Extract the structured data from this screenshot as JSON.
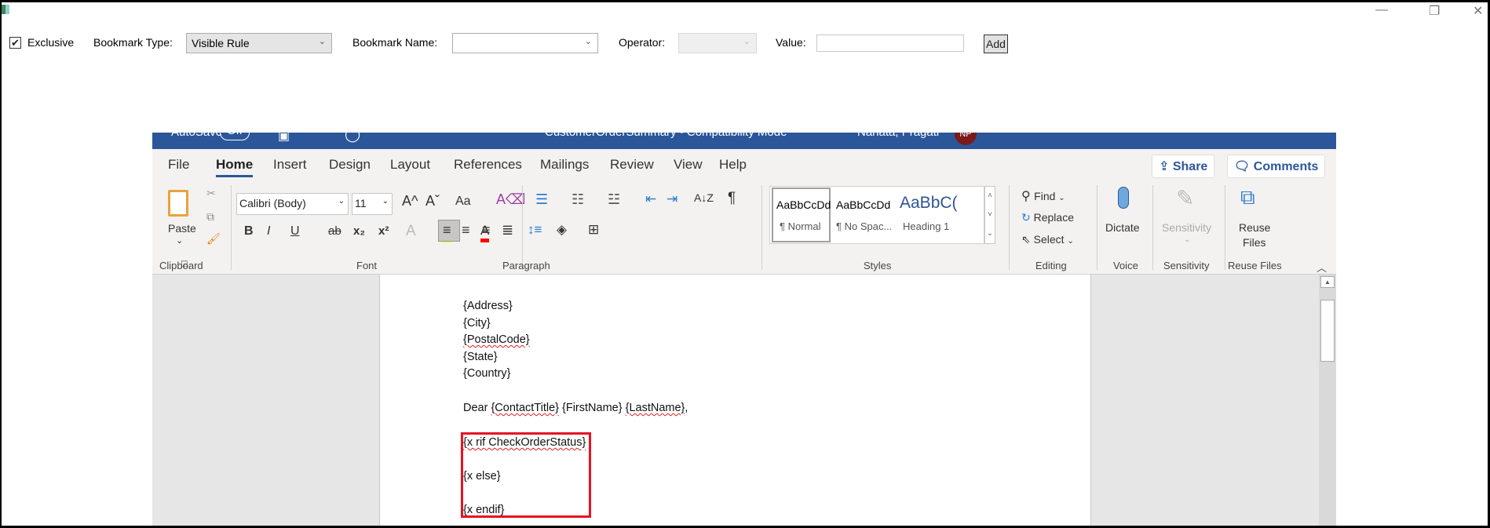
{
  "toolbar": {
    "exclusive_label": "Exclusive",
    "exclusive_checked": true,
    "bookmark_type_label": "Bookmark Type:",
    "bookmark_type_value": "Visible Rule",
    "bookmark_name_label": "Bookmark Name:",
    "bookmark_name_value": "",
    "operator_label": "Operator:",
    "operator_value": "",
    "value_label": "Value:",
    "value_value": "",
    "add_label": "Add"
  },
  "window_controls": {
    "minimize": "—",
    "restore": "❐",
    "close": "✕"
  },
  "word": {
    "titlebar": {
      "autosave": "AutoSave",
      "autosave_state": "Off",
      "doc_title": "CustomerOrderSummary - Compatibility Mode",
      "user": "Nanata, Pragati",
      "avatar": "NP"
    },
    "tabs": [
      "File",
      "Home",
      "Insert",
      "Design",
      "Layout",
      "References",
      "Mailings",
      "Review",
      "View",
      "Help"
    ],
    "active_tab": "Home",
    "share_label": "Share",
    "comments_label": "Comments",
    "clipboard": {
      "paste": "Paste",
      "label": "Clipboard"
    },
    "font": {
      "name": "Calibri (Body)",
      "size": "11",
      "label": "Font",
      "grow": "A^",
      "shrink": "Aˇ",
      "change_case": "Aa",
      "bold": "B",
      "italic": "I",
      "underline": "U",
      "strike": "ab",
      "sub": "x₂",
      "sup": "x²",
      "effects": "A",
      "font_color": "A"
    },
    "paragraph": {
      "label": "Paragraph",
      "pilcrow": "¶",
      "sort": "A↓Z"
    },
    "styles": {
      "label": "Styles",
      "items": [
        {
          "preview": "AaBbCcDd",
          "name": "¶ Normal"
        },
        {
          "preview": "AaBbCcDd",
          "name": "¶ No Spac..."
        },
        {
          "preview": "AaBbC(",
          "name": "Heading 1"
        }
      ]
    },
    "editing": {
      "label": "Editing",
      "find": "Find",
      "replace": "Replace",
      "select": "Select"
    },
    "voice": {
      "label": "Voice",
      "dictate": "Dictate"
    },
    "sensitivity": {
      "label": "Sensitivity",
      "button": "Sensitivity"
    },
    "reuse": {
      "label": "Reuse Files",
      "button_line1": "Reuse",
      "button_line2": "Files"
    }
  },
  "document": {
    "lines": [
      "{Address}",
      "{City}",
      "{PostalCode}",
      "{State}",
      "{Country}"
    ],
    "dear": "Dear",
    "contact_title": "{ContactTitle}",
    "first_name": "{FirstName}",
    "last_name": "{LastName}",
    "comma": ",",
    "rule_if": "{x rif CheckOrderStatus}",
    "rule_else": "{x else}",
    "rule_endif": "{x endif}"
  },
  "colors": {
    "word_blue": "#2b579a",
    "highlight_red": "#e81123"
  }
}
